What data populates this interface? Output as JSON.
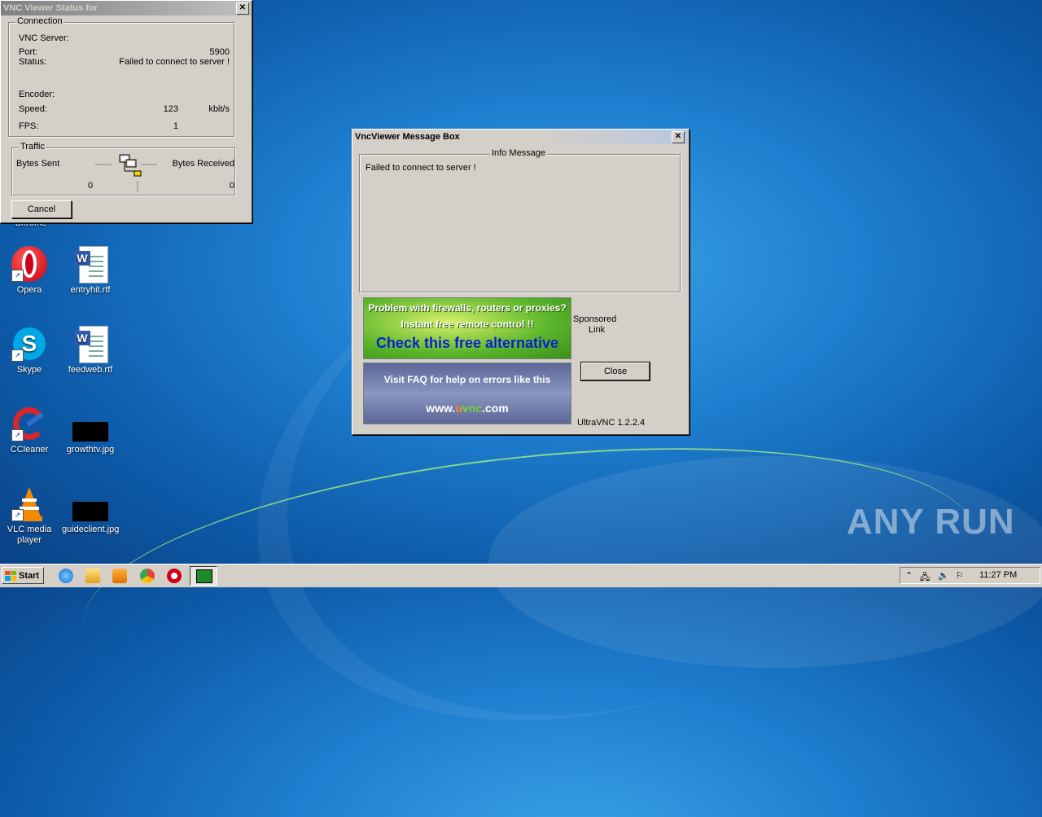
{
  "desktop": {
    "icons": [
      {
        "label": "Opera",
        "icon": "opera-icon"
      },
      {
        "label": "entryhit.rtf",
        "icon": "word-document-icon"
      },
      {
        "label": "Skype",
        "icon": "skype-icon"
      },
      {
        "label": "feedweb.rtf",
        "icon": "word-document-icon"
      },
      {
        "label": "CCleaner",
        "icon": "ccleaner-icon"
      },
      {
        "label": "growthtv.jpg",
        "icon": "image-thumbnail-icon"
      },
      {
        "label": "VLC media player",
        "icon": "vlc-icon"
      },
      {
        "label": "guideclient.jpg",
        "icon": "image-thumbnail-icon"
      }
    ],
    "partial_label": "Chrome",
    "watermark": "ANY RUN"
  },
  "status_window": {
    "title": "VNC Viewer Status for",
    "connection_group": "Connection",
    "vnc_server_label": "VNC Server:",
    "port_label": "Port:",
    "port_value": "5900",
    "status_label": "Status:",
    "status_value": "Failed to connect to server !",
    "encoder_label": "Encoder:",
    "speed_label": "Speed:",
    "speed_value": "123",
    "speed_unit": "kbit/s",
    "fps_label": "FPS:",
    "fps_value": "1",
    "traffic_group": "Traffic",
    "bytes_sent_label": "Bytes Sent",
    "bytes_received_label": "Bytes Received",
    "bytes_sent_value": "0",
    "bytes_received_value": "0",
    "cancel_label": "Cancel"
  },
  "message_box": {
    "title": "VncViewer Message Box",
    "info_group": "Info Message",
    "message": "Failed to connect to server !",
    "ad_line1": "Problem with firewalls, routers or proxies?",
    "ad_line2": "Instant free remote control !!",
    "ad_line3": "Check this free alternative",
    "faq_line": "Visit FAQ for help on errors like this",
    "site_www": "www.",
    "site_u": "u",
    "site_vnc": "vnc",
    "site_com": ".com",
    "sponsored": "Sponsored",
    "sponsored2": "Link",
    "close_label": "Close",
    "version": "UltraVNC 1.2.2.4"
  },
  "taskbar": {
    "start_label": "Start",
    "clock": "11:27 PM",
    "quick_launch": [
      "internet-explorer-icon",
      "explorer-folder-icon",
      "media-player-icon",
      "chrome-icon",
      "opera-icon",
      "vnc-viewer-icon"
    ]
  },
  "colors": {
    "ad_green": "#5ab52a",
    "ad_blue_text": "#0a1fd0",
    "faq_bg": "#6b78a8",
    "site_orange": "#ff8c1a"
  }
}
